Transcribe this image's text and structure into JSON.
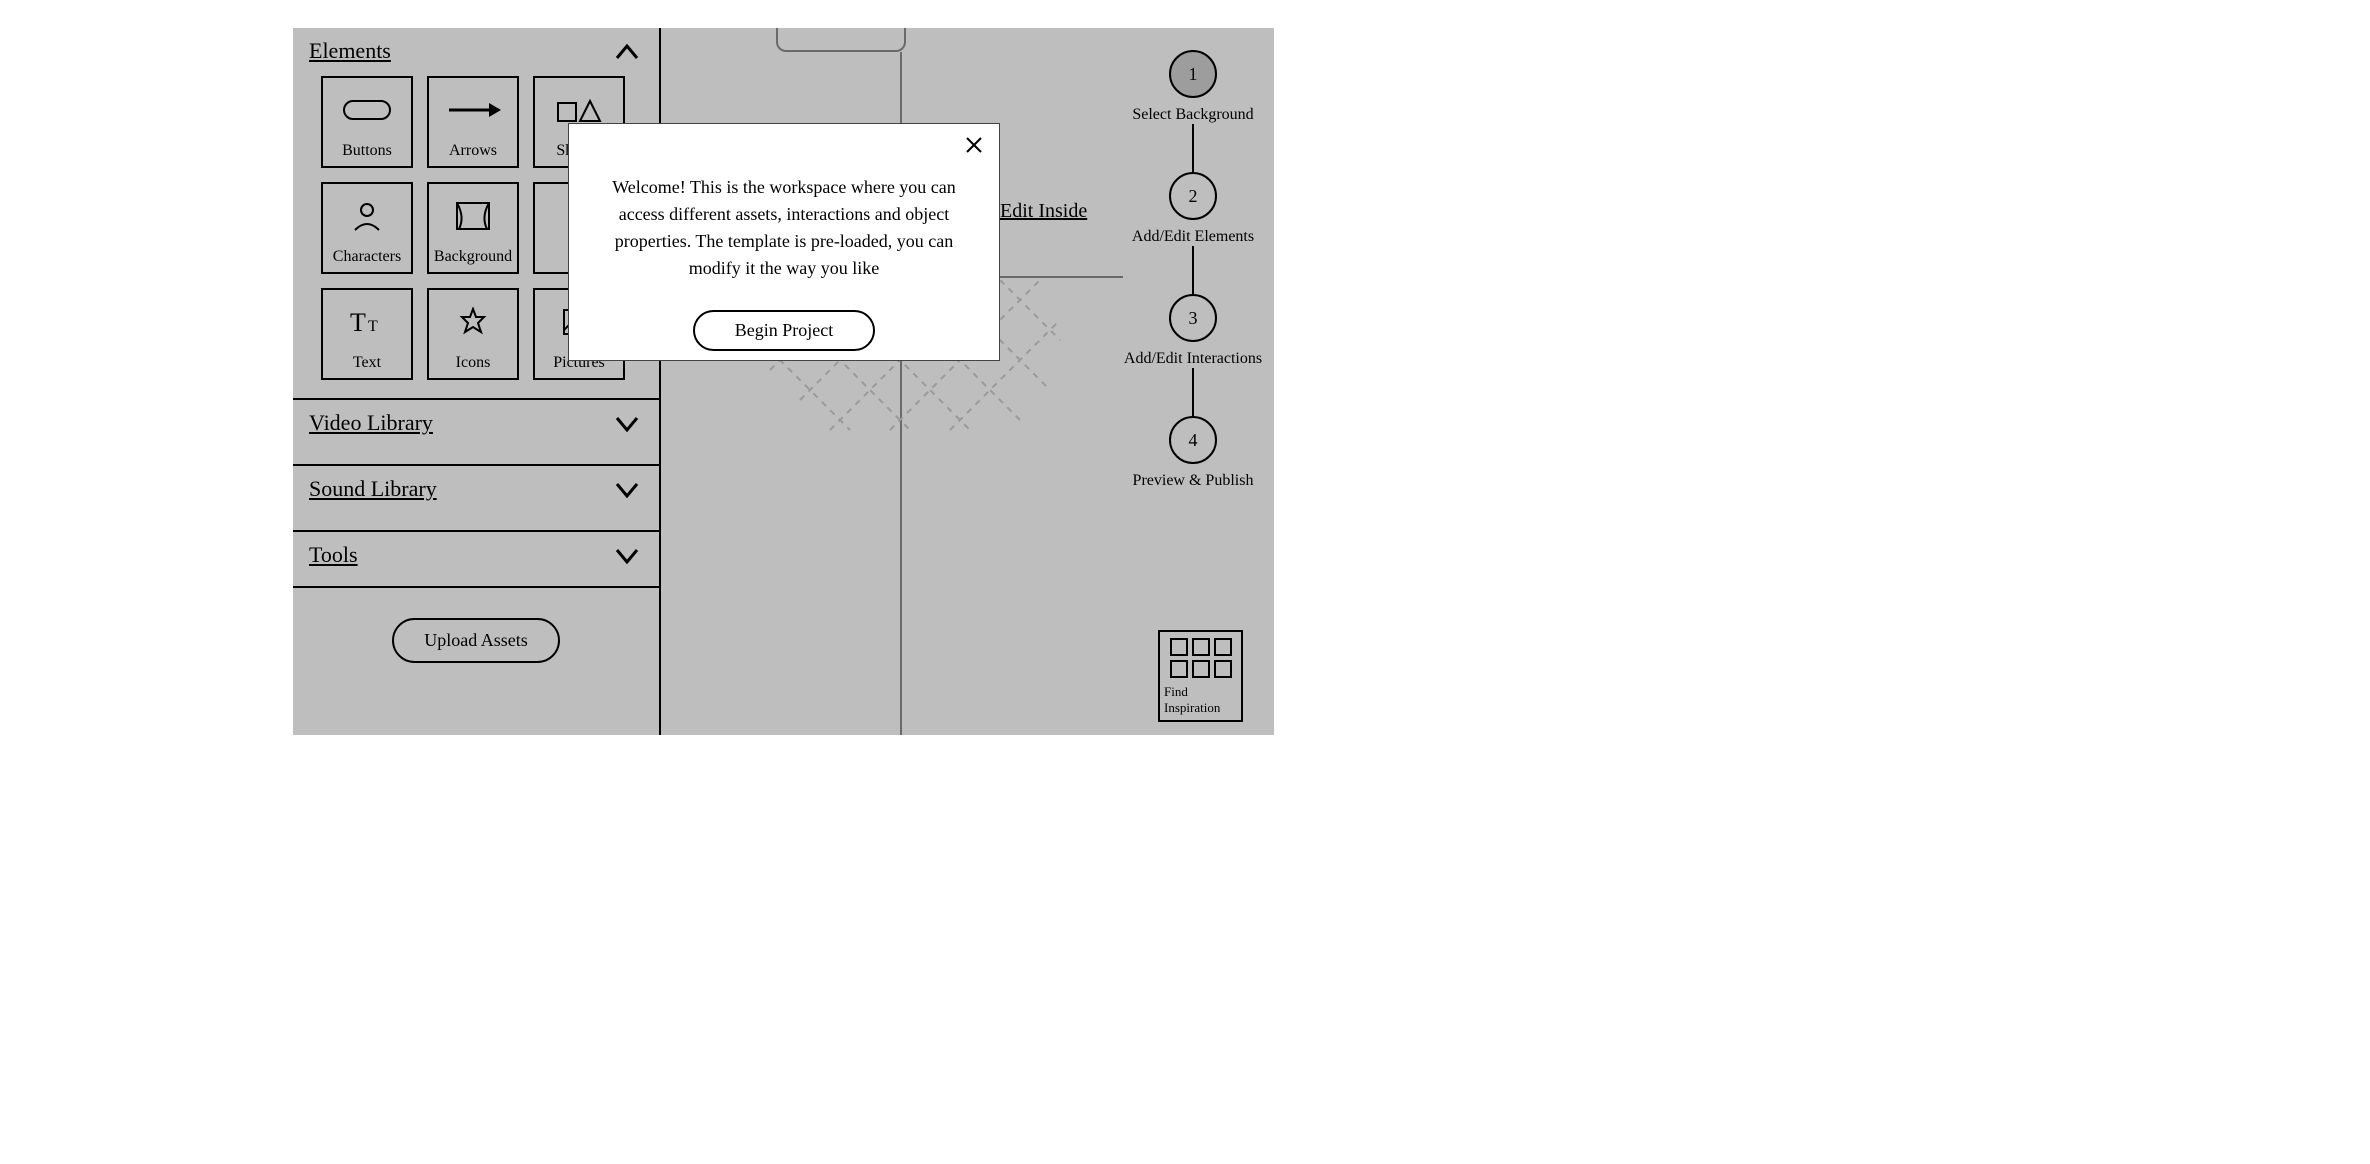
{
  "sidebar": {
    "sections": {
      "elements": {
        "title": "Elements"
      },
      "video": {
        "title": "Video Library"
      },
      "sound": {
        "title": "Sound Library"
      },
      "tools": {
        "title": "Tools"
      }
    },
    "tiles": [
      {
        "label": "Buttons"
      },
      {
        "label": "Arrows"
      },
      {
        "label": "Shapes"
      },
      {
        "label": "Characters"
      },
      {
        "label": "Background"
      },
      {
        "label": ""
      },
      {
        "label": "Text"
      },
      {
        "label": "Icons"
      },
      {
        "label": "Pictures"
      }
    ],
    "upload_label": "Upload Assets"
  },
  "canvas": {
    "edit_inside": "Edit Inside"
  },
  "stepper": [
    {
      "num": "1",
      "label": "Select Background"
    },
    {
      "num": "2",
      "label": "Add/Edit Elements"
    },
    {
      "num": "3",
      "label": "Add/Edit Interactions"
    },
    {
      "num": "4",
      "label": "Preview & Publish"
    }
  ],
  "inspire": {
    "label": "Find Inspiration"
  },
  "modal": {
    "message": "Welcome! This is the workspace where you can access different assets, interactions and object properties. The template is pre-loaded, you can modify it the way you like",
    "begin": "Begin Project"
  }
}
